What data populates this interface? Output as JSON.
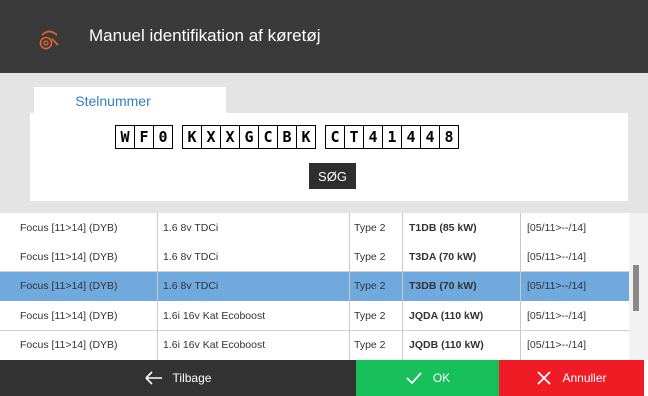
{
  "window": {
    "title": "Manuel identifikation af køretøj",
    "icon": "car-search-icon"
  },
  "vin_panel": {
    "tab_label": "Stelnummer",
    "groups": [
      [
        "W",
        "F",
        "0"
      ],
      [
        "K",
        "X",
        "X",
        "G",
        "C",
        "B",
        "K"
      ],
      [
        "C",
        "T",
        "4",
        "1",
        "4",
        "4",
        "8"
      ]
    ],
    "search_label": "SØG"
  },
  "table": {
    "rows": [
      {
        "model": "Focus [11>14] (DYB)",
        "engine": "1.6 8v TDCi",
        "type": "Type 2",
        "code": "T1DB (85 kW)",
        "period": "[05/11>--/14]",
        "selected": false
      },
      {
        "model": "Focus [11>14] (DYB)",
        "engine": "1.6 8v TDCi",
        "type": "Type 2",
        "code": "T3DA (70 kW)",
        "period": "[05/11>--/14]",
        "selected": false
      },
      {
        "model": "Focus [11>14] (DYB)",
        "engine": "1.6 8v TDCi",
        "type": "Type 2",
        "code": "T3DB (70 kW)",
        "period": "[05/11>--/14]",
        "selected": true
      },
      {
        "model": "Focus [11>14] (DYB)",
        "engine": "1.6i 16v Kat Ecoboost",
        "type": "Type 2",
        "code": "JQDA (110 kW)",
        "period": "[05/11>--/14]",
        "selected": false
      },
      {
        "model": "Focus [11>14] (DYB)",
        "engine": "1.6i 16v Kat Ecoboost",
        "type": "Type 2",
        "code": "JQDB (110 kW)",
        "period": "[05/11>--/14]",
        "selected": false
      }
    ]
  },
  "footer": {
    "back_label": "Tilbage",
    "ok_label": "OK",
    "cancel_label": "Annuller"
  },
  "colors": {
    "titlebar": "#3a3a3a",
    "accent_orange": "#e8612c",
    "tab_text": "#2f7fc1",
    "selected_row": "#6fa9de",
    "ok_green": "#17c05a",
    "cancel_red": "#ef1c25"
  }
}
